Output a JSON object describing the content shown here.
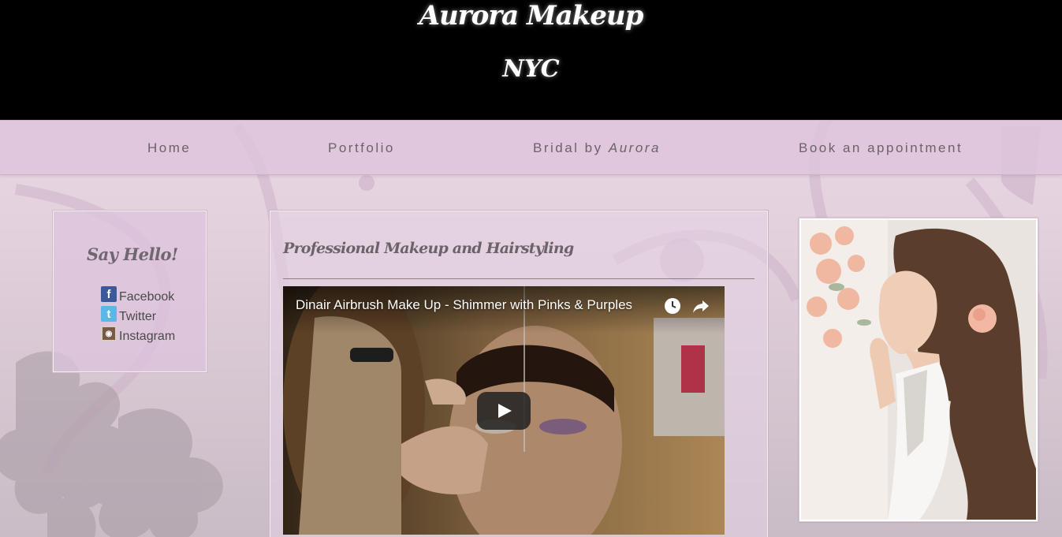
{
  "header": {
    "title": "Aurora Makeup",
    "subtitle": "NYC"
  },
  "nav": {
    "items": [
      {
        "label": "Home"
      },
      {
        "label": "Portfolio"
      },
      {
        "label_prefix": "Bridal by ",
        "label_emphasis": "Aurora"
      },
      {
        "label": "Book an appointment"
      }
    ]
  },
  "social": {
    "heading": "Say Hello!",
    "links": [
      {
        "label": "Facebook",
        "icon": "facebook-icon",
        "glyph": "f"
      },
      {
        "label": "Twitter",
        "icon": "twitter-icon",
        "glyph": "t"
      },
      {
        "label": "Instagram",
        "icon": "instagram-icon",
        "glyph": "◉"
      }
    ]
  },
  "content": {
    "heading": "Professional Makeup and Hairstyling",
    "video": {
      "title": "Dinair Airbrush Make Up - Shimmer with Pinks & Purples",
      "controls": [
        "watch-later-icon",
        "share-icon",
        "play-icon"
      ]
    }
  },
  "colors": {
    "header_bg": "#000000",
    "nav_bg": "#dec4dc",
    "text_muted": "#6c6368"
  }
}
